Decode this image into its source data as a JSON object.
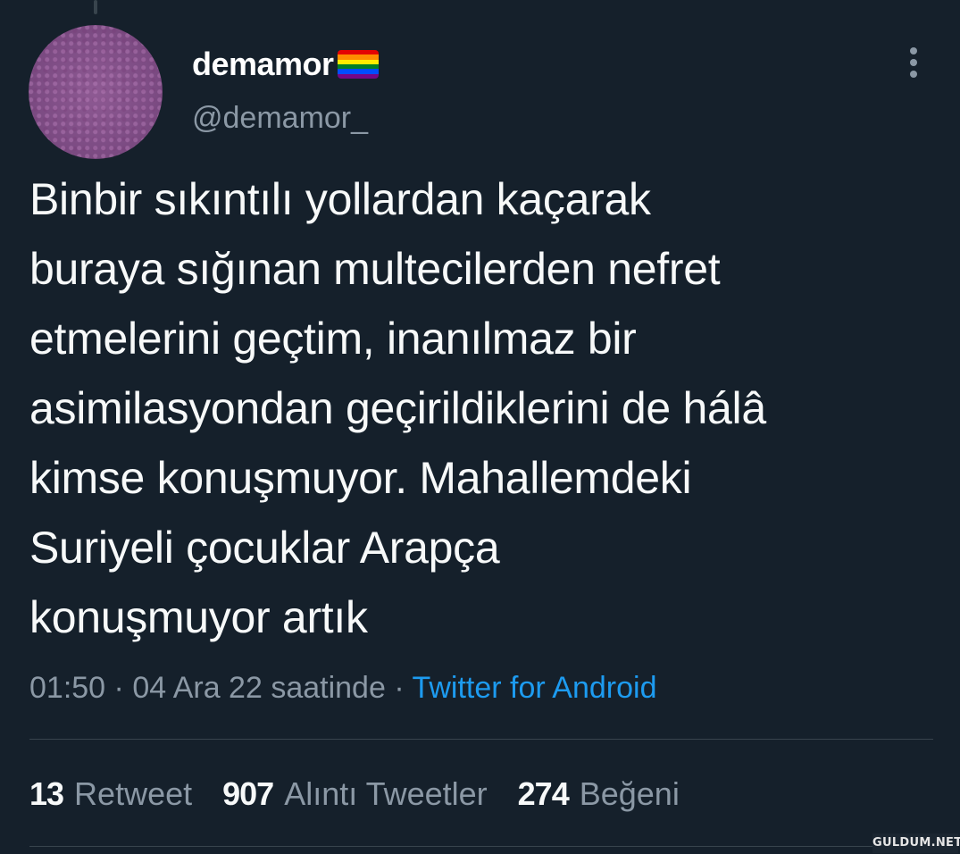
{
  "author": {
    "display_name": "demamor",
    "flag_icon": "rainbow-flag-icon",
    "handle": "@demamor_"
  },
  "tweet": {
    "text": "Binbir sıkıntılı yollardan kaçarak\nburaya sığınan multecilerden nefret\netmelerini geçtim, inanılmaz bir\nasimilasyondan geçirildiklerini de hálâ\nkimse konuşmuyor. Mahallemdeki\nSuriyeli  çocuklar Arapça\nkonuşmuyor artık"
  },
  "meta": {
    "time": "01:50",
    "separator": " · ",
    "date": "04 Ara 22 saatinde",
    "source": "Twitter for Android"
  },
  "stats": [
    {
      "count": "13",
      "label": "Retweet"
    },
    {
      "count": "907",
      "label": "Alıntı Tweetler"
    },
    {
      "count": "274",
      "label": "Beğeni"
    }
  ],
  "watermark": "GULDUM.NET",
  "colors": {
    "background": "#15202b",
    "text_primary": "#f7f9f9",
    "text_secondary": "#8b98a5",
    "link": "#1d9bf0",
    "divider": "#38444d",
    "flag_stripes": [
      "#e40303",
      "#ff8c00",
      "#ffed00",
      "#008026",
      "#004dff",
      "#750787"
    ]
  }
}
